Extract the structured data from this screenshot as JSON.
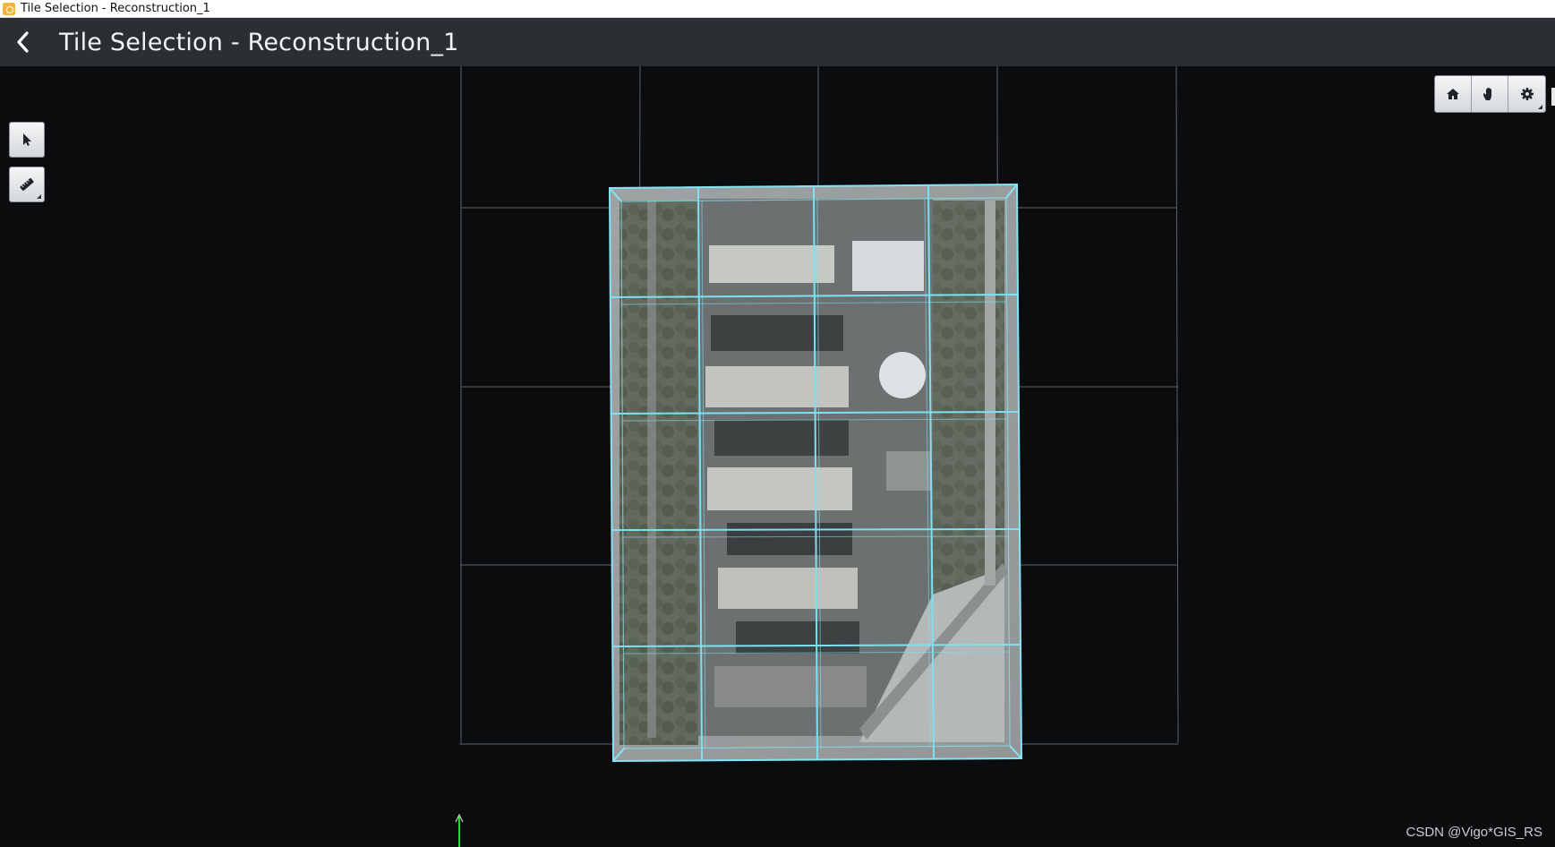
{
  "window": {
    "title": "Tile Selection - Reconstruction_1"
  },
  "header": {
    "back_icon": "chevron-left-icon",
    "title": "Tile Selection - Reconstruction_1"
  },
  "left_toolbar": {
    "tools": [
      {
        "name": "select-tool",
        "icon": "cursor-arrow-icon"
      },
      {
        "name": "measure-tool",
        "icon": "ruler-icon"
      }
    ]
  },
  "right_toolbar": {
    "tools": [
      {
        "name": "home-view",
        "icon": "home-icon"
      },
      {
        "name": "pan",
        "icon": "hand-icon"
      },
      {
        "name": "settings",
        "icon": "gear-icon"
      }
    ]
  },
  "scene": {
    "tile_grid": {
      "columns": 4,
      "rows": 5
    },
    "colors": {
      "background": "#0b0c0e",
      "grid_line": "#6d7378",
      "tile_edge": "#7fe0ef",
      "axis_y": "#2bd43c"
    }
  },
  "watermark": "CSDN @Vigo*GIS_RS"
}
